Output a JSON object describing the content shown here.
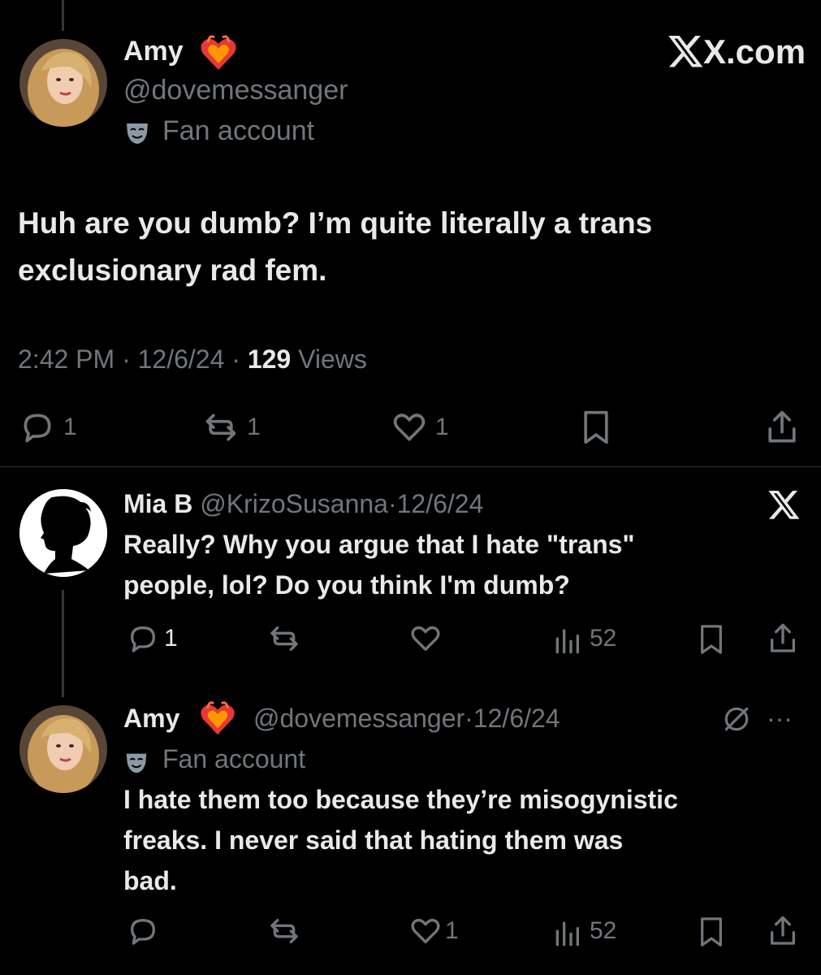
{
  "brand": {
    "site": "X.com"
  },
  "main_post": {
    "display_name": "Amy",
    "handle": "@dovemessanger",
    "label": "Fan account",
    "text_line1": "Huh are you dumb? I’m quite literally a trans",
    "text_line2": "exclusionary rad fem.",
    "time": "2:42 PM",
    "date": "12/6/24",
    "views_count": "129",
    "views_label": "Views",
    "separator": "·",
    "actions": {
      "replies": "1",
      "reposts": "1",
      "likes": "1"
    }
  },
  "reply_1": {
    "display_name": "Mia B",
    "handle": "@KrizoSusanna",
    "separator": "·",
    "date": "12/6/24",
    "text_line1": "Really? Why you argue that I hate \"trans\"",
    "text_line2": "people, lol? Do you think I'm dumb?",
    "actions": {
      "replies": "1",
      "views": "52"
    }
  },
  "reply_2": {
    "display_name": "Amy",
    "handle": "@dovemessanger",
    "separator": "·",
    "date": "12/6/24",
    "label": "Fan account",
    "text_line1": "I hate them too because they’re misogynistic",
    "text_line2": "freaks. I never said that hating them was",
    "text_line3": "bad.",
    "actions": {
      "likes": "1",
      "views": "52"
    },
    "more": "···"
  },
  "colors": {
    "background": "#000000",
    "text": "#e7e9ea",
    "muted": "#71767b",
    "divider": "#2f3336"
  }
}
